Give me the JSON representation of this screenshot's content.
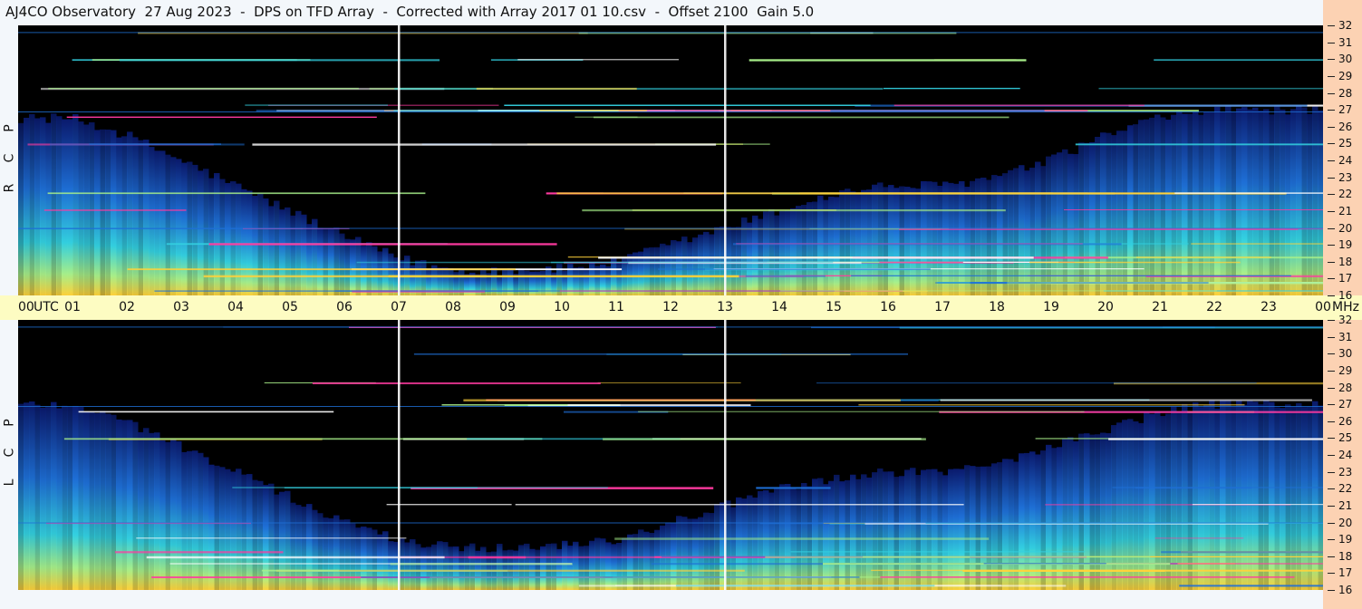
{
  "title": "AJ4CO Observatory  27 Aug 2023  -  DPS on TFD Array  -  Corrected with Array 2017 01 10.csv  -  Offset 2100  Gain 5.0",
  "chart_data": [
    {
      "type": "heatmap",
      "panel": "RCP",
      "polarization_letters": [
        "R",
        "C",
        "P"
      ],
      "x_axis": {
        "label": "UTC",
        "ticks": [
          "00",
          "01",
          "02",
          "03",
          "04",
          "05",
          "06",
          "07",
          "08",
          "09",
          "10",
          "11",
          "12",
          "13",
          "14",
          "15",
          "16",
          "17",
          "18",
          "19",
          "20",
          "21",
          "22",
          "23",
          "00"
        ],
        "range_hours": [
          0,
          24
        ]
      },
      "y_axis": {
        "unit": "MHz",
        "ticks": [
          "16",
          "17",
          "18",
          "19",
          "20",
          "21",
          "22",
          "23",
          "24",
          "25",
          "26",
          "27",
          "28",
          "29",
          "30",
          "31",
          "32"
        ],
        "range_mhz": [
          16,
          32
        ]
      },
      "vertical_markers_utc_hours": [
        7.0,
        13.0
      ],
      "intensity_profile_hours": [
        0,
        1,
        2,
        3,
        4,
        5,
        6,
        7,
        8,
        9,
        10,
        11,
        12,
        13,
        14,
        15,
        16,
        17,
        18,
        19,
        20,
        21,
        22,
        23,
        24
      ],
      "cutoff_mhz": [
        26.5,
        26.5,
        25.5,
        24.0,
        22.5,
        21.0,
        19.5,
        18.2,
        17.5,
        17.5,
        17.6,
        18.0,
        19.0,
        20.0,
        21.0,
        22.0,
        22.5,
        22.5,
        23.0,
        24.0,
        25.5,
        26.5,
        27.0,
        27.0,
        27.0
      ]
    },
    {
      "type": "heatmap",
      "panel": "LCP",
      "polarization_letters": [
        "L",
        "C",
        "P"
      ],
      "x_axis": {
        "label": "UTC",
        "ticks": [
          "00",
          "01",
          "02",
          "03",
          "04",
          "05",
          "06",
          "07",
          "08",
          "09",
          "10",
          "11",
          "12",
          "13",
          "14",
          "15",
          "16",
          "17",
          "18",
          "19",
          "20",
          "21",
          "22",
          "23",
          "00"
        ],
        "range_hours": [
          0,
          24
        ]
      },
      "y_axis": {
        "unit": "MHz",
        "ticks": [
          "16",
          "17",
          "18",
          "19",
          "20",
          "21",
          "22",
          "23",
          "24",
          "25",
          "26",
          "27",
          "28",
          "29",
          "30",
          "31",
          "32"
        ],
        "range_mhz": [
          16,
          32
        ]
      },
      "vertical_markers_utc_hours": [
        7.0,
        13.0
      ],
      "intensity_profile_hours": [
        0,
        1,
        2,
        3,
        4,
        5,
        6,
        7,
        8,
        9,
        10,
        11,
        12,
        13,
        14,
        15,
        16,
        17,
        18,
        19,
        20,
        21,
        22,
        23,
        24
      ],
      "cutoff_mhz": [
        27.0,
        27.0,
        26.0,
        24.5,
        23.0,
        21.5,
        20.0,
        19.0,
        18.5,
        18.5,
        18.7,
        19.0,
        20.0,
        21.0,
        22.0,
        22.5,
        23.0,
        23.0,
        23.5,
        24.5,
        25.5,
        26.5,
        27.0,
        27.0,
        27.0
      ]
    }
  ],
  "colors": {
    "background": "#000000",
    "low": "#0a1a6e",
    "mid": "#1e6fd6",
    "high": "#33d0e0",
    "higher": "#a8f08a",
    "peak": "#ffd23a",
    "spike": "#ff3aa0",
    "marker": "#ffffff",
    "time_axis_strip": "#fdfcc2",
    "freq_axis_strip": "#fcd2b3"
  },
  "freq_unit_label": "MHz"
}
